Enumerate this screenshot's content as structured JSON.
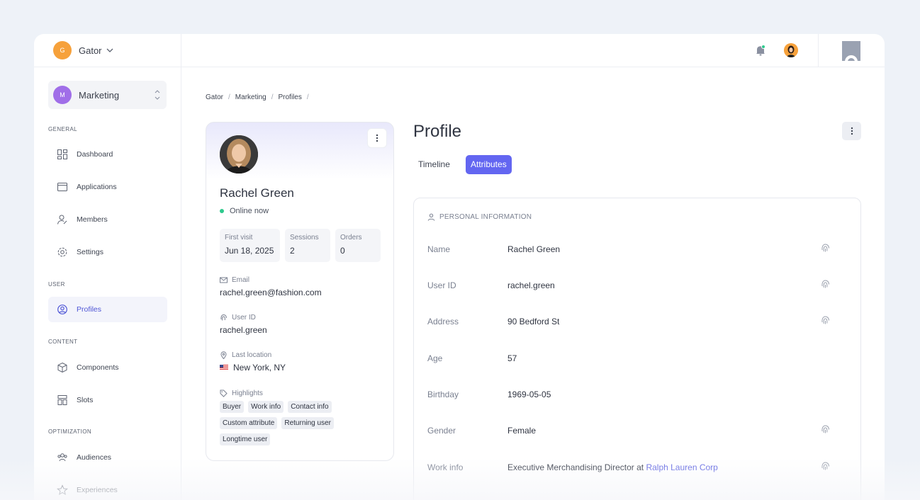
{
  "org": {
    "initial": "G",
    "name": "Gator"
  },
  "workspace": {
    "initial": "M",
    "name": "Marketing"
  },
  "sidebar": {
    "sections": [
      {
        "label": "GENERAL"
      },
      {
        "label": "USER"
      },
      {
        "label": "CONTENT"
      },
      {
        "label": "OPTIMIZATION"
      }
    ],
    "items": [
      {
        "label": "Dashboard",
        "icon": "dashboard-icon"
      },
      {
        "label": "Applications",
        "icon": "window-icon"
      },
      {
        "label": "Members",
        "icon": "members-icon"
      },
      {
        "label": "Settings",
        "icon": "gear-icon"
      },
      {
        "label": "Profiles",
        "icon": "profile-icon",
        "active": true
      },
      {
        "label": "Components",
        "icon": "cube-icon"
      },
      {
        "label": "Slots",
        "icon": "slots-icon"
      },
      {
        "label": "Audiences",
        "icon": "audiences-icon"
      },
      {
        "label": "Experiences",
        "icon": "star-icon"
      }
    ]
  },
  "breadcrumb": [
    "Gator",
    "Marketing",
    "Profiles"
  ],
  "profile": {
    "name": "Rachel Green",
    "status": "Online now",
    "stats": [
      {
        "label": "First visit",
        "value": "Jun 18, 2025"
      },
      {
        "label": "Sessions",
        "value": "2"
      },
      {
        "label": "Orders",
        "value": "0"
      }
    ],
    "email_label": "Email",
    "email": "rachel.green@fashion.com",
    "userid_label": "User ID",
    "userid": "rachel.green",
    "location_label": "Last location",
    "location": "New York, NY",
    "highlights_label": "Highlights",
    "highlights": [
      "Buyer",
      "Work info",
      "Contact info",
      "Custom attribute",
      "Returning user",
      "Longtime user"
    ]
  },
  "main": {
    "title": "Profile",
    "tabs": [
      {
        "label": "Timeline",
        "active": false
      },
      {
        "label": "Attributes",
        "active": true
      }
    ],
    "section_title": "PERSONAL INFORMATION",
    "attributes": [
      {
        "label": "Name",
        "value": "Rachel Green",
        "fingerprint": true
      },
      {
        "label": "User ID",
        "value": "rachel.green",
        "fingerprint": true
      },
      {
        "label": "Address",
        "value": "90 Bedford St",
        "fingerprint": true
      },
      {
        "label": "Age",
        "value": "57",
        "fingerprint": false
      },
      {
        "label": "Birthday",
        "value": "1969-05-05",
        "fingerprint": false
      },
      {
        "label": "Gender",
        "value": "Female",
        "fingerprint": true
      },
      {
        "label": "Work info",
        "value": "Executive Merchandising Director at",
        "link": "Ralph Lauren Corp",
        "fingerprint": true
      }
    ]
  },
  "colors": {
    "accent": "#6366f1",
    "online": "#2ec98d",
    "org": "#f6a13b",
    "workspace": "#a06ee8"
  }
}
